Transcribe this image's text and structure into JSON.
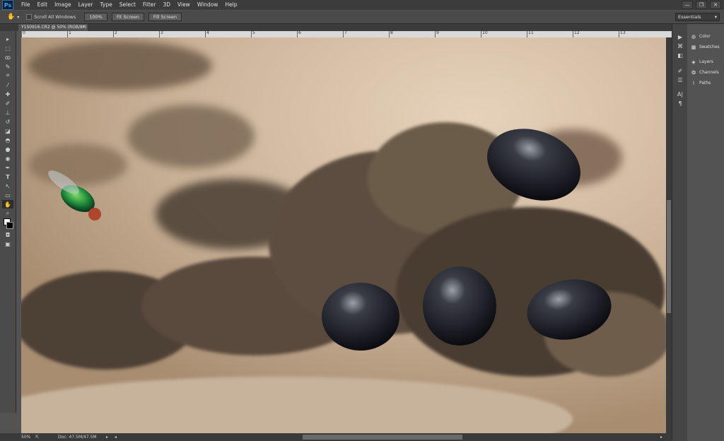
{
  "app": {
    "logo": "Ps"
  },
  "menu": [
    "File",
    "Edit",
    "Image",
    "Layer",
    "Type",
    "Select",
    "Filter",
    "3D",
    "View",
    "Window",
    "Help"
  ],
  "window_controls": [
    "—",
    "❐",
    "✕"
  ],
  "options_bar": {
    "scroll_all_windows": "Scroll All Windows",
    "zoom_100": "100%",
    "fit_screen": "Fit Screen",
    "fill_screen": "Fill Screen",
    "workspace": "Essentials"
  },
  "document": {
    "tab_title": "Y1S0916.CR2 @ 50% (RGB/8*)",
    "close": "×"
  },
  "ruler_labels": [
    "0",
    "1",
    "2",
    "3",
    "4",
    "5",
    "6",
    "7",
    "8",
    "9",
    "10",
    "11",
    "12",
    "13"
  ],
  "status": {
    "zoom": "50%",
    "doc": "Doc: 47.5M/47.5M"
  },
  "panels": [
    {
      "label": "Color",
      "icon": "color-icon"
    },
    {
      "label": "Swatches",
      "icon": "swatches-icon"
    },
    {
      "label": "Layers",
      "icon": "layers-icon"
    },
    {
      "label": "Channels",
      "icon": "channels-icon"
    },
    {
      "label": "Paths",
      "icon": "paths-icon"
    }
  ]
}
